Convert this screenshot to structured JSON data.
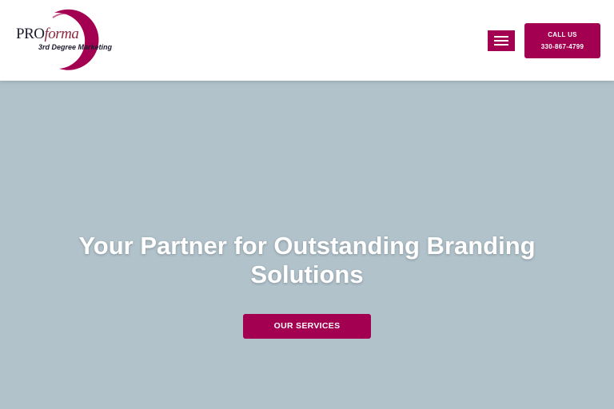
{
  "header": {
    "logo": {
      "wordmark_pro": "PRO",
      "wordmark_forma": "forma",
      "tagline": "3rd Degree Marketing"
    },
    "menu_icon": "hamburger-menu-icon",
    "call_button": {
      "line1": "CALL US",
      "line2": "330-867-4799"
    }
  },
  "hero": {
    "title": "Your Partner for Outstanding Branding Solutions",
    "cta_label": "OUR SERVICES"
  },
  "colors": {
    "accent": "#a30051",
    "hero_background": "#b1c2cb",
    "header_background": "#ffffff",
    "logo_dark": "#1e1a2e"
  }
}
